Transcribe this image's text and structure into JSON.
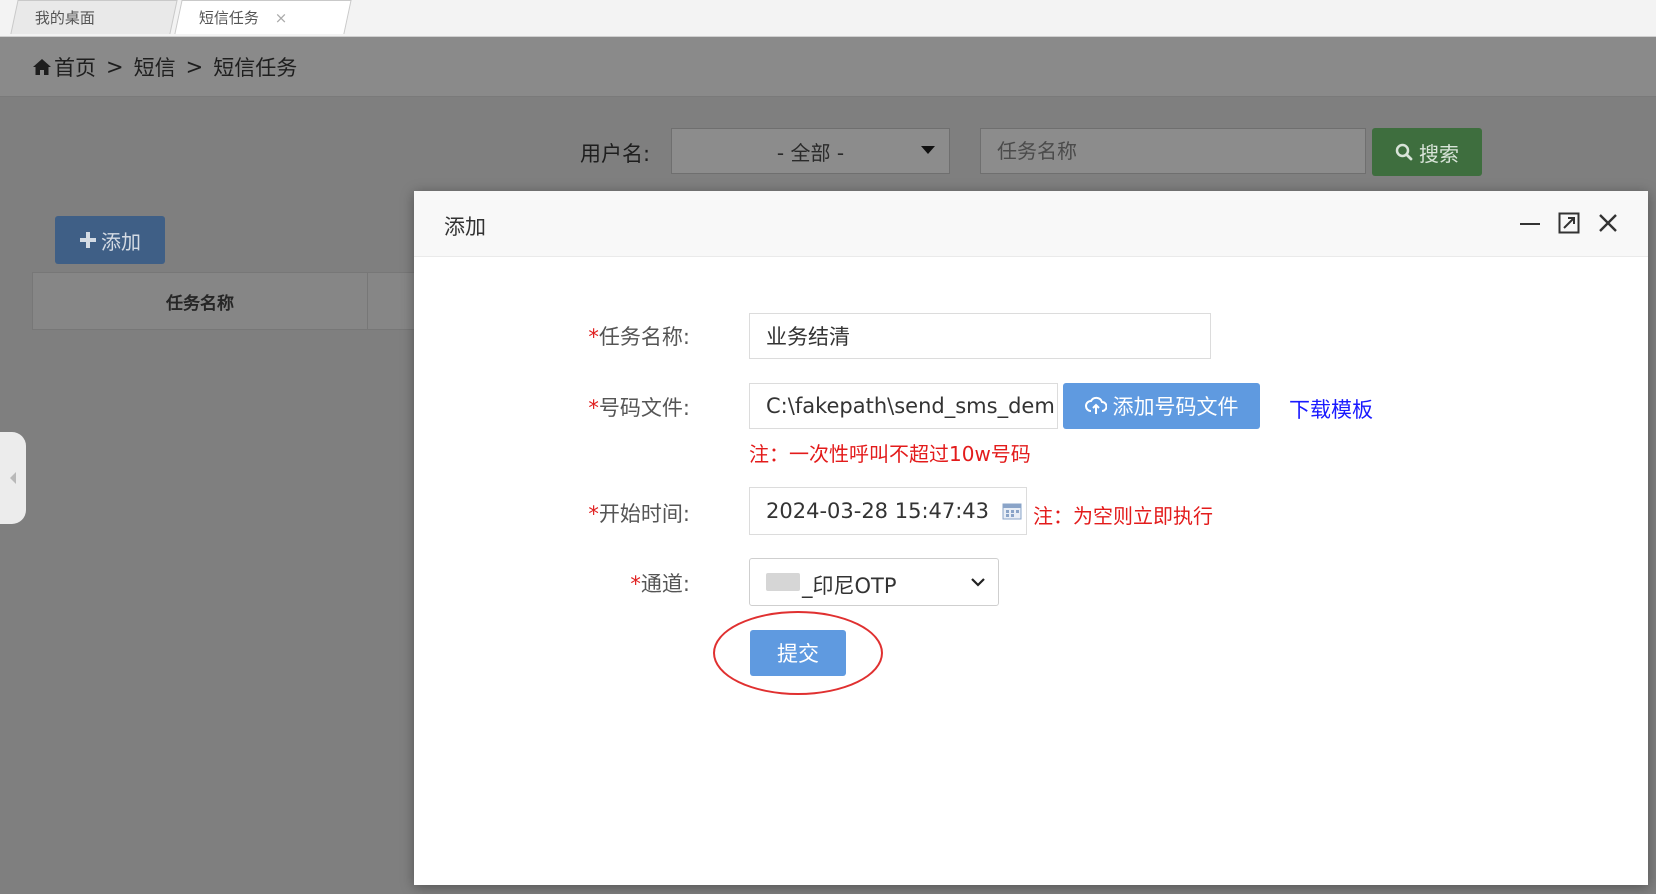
{
  "tabs": [
    {
      "label": "我的桌面"
    },
    {
      "label": "短信任务",
      "close": "×"
    }
  ],
  "breadcrumb": {
    "home": "首页",
    "sep": ">",
    "level1": "短信",
    "level2": "短信任务"
  },
  "search": {
    "username_label": "用户名:",
    "username_value": "- 全部 -",
    "task_placeholder": "任务名称",
    "search_label": "搜索"
  },
  "list": {
    "add_label": "添加",
    "columns": [
      "任务名称"
    ]
  },
  "modal": {
    "title": "添加",
    "form": {
      "required_mark": "*",
      "task_name_label": "任务名称:",
      "task_name_value": "业务结清",
      "file_label": "号码文件:",
      "file_value": "C:\\fakepath\\send_sms_dem",
      "file_button": "添加号码文件",
      "download_link": "下载模板",
      "file_note": "注：一次性呼叫不超过10w号码",
      "start_time_label": "开始时间:",
      "start_time_value": "2024-03-28 15:47:43",
      "start_time_note": "注：为空则立即执行",
      "channel_label": "通道:",
      "channel_value": "_印尼OTP",
      "submit_label": "提交"
    }
  },
  "colors": {
    "primary_blue": "#5f9ae0",
    "search_green": "#3e6e3e",
    "note_red": "#e31b1b",
    "link_blue": "#1a1aff",
    "annotation_red": "#e03030"
  }
}
